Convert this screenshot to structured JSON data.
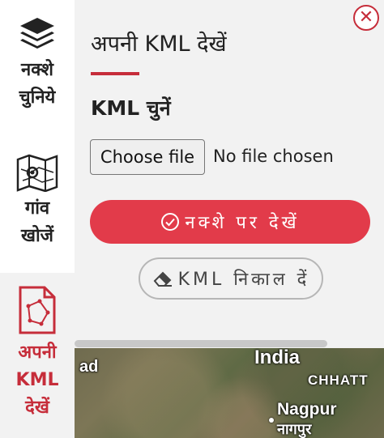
{
  "sidebar": {
    "items": [
      {
        "label": "नक्शे चुनिये",
        "icon": "layers-icon",
        "active": false
      },
      {
        "label": "गांव खोजें",
        "icon": "map-pin-icon",
        "active": false
      },
      {
        "label": "अपनी KML देखें",
        "icon": "kml-file-icon",
        "active": true
      }
    ]
  },
  "panel": {
    "title": "अपनी KML देखें",
    "section_label": "KML चुनें",
    "file_button_label": "Choose file",
    "file_status": "No file chosen",
    "view_button_label": "नक्शे पर देखें",
    "remove_button_label": "KML निकाल दें",
    "close_icon": "close-icon"
  },
  "map": {
    "labels": {
      "india": "India",
      "partial_left": "ad",
      "chhatt": "CHHATT",
      "nagpur": "Nagpur",
      "nagpur_hindi": "नागपुर"
    }
  },
  "colors": {
    "accent": "#c62d3a",
    "primary_button": "#e23b4a",
    "panel_bg": "#f2f2f2"
  }
}
